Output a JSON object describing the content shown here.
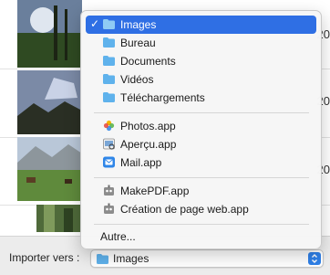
{
  "list": {
    "rows": [
      {
        "date_fragment": "20"
      },
      {
        "date_fragment": "20"
      },
      {
        "date_fragment": "20"
      },
      {
        "date_fragment": ""
      }
    ]
  },
  "footer": {
    "label": "Importer vers :",
    "selected_value": "Images"
  },
  "menu": {
    "folders": [
      {
        "label": "Images",
        "checked": "✓",
        "icon": "folder-icon"
      },
      {
        "label": "Bureau",
        "icon": "folder-icon"
      },
      {
        "label": "Documents",
        "icon": "folder-icon"
      },
      {
        "label": "Vidéos",
        "icon": "folder-icon"
      },
      {
        "label": "Téléchargements",
        "icon": "folder-icon"
      }
    ],
    "apps": [
      {
        "label": "Photos.app",
        "icon": "photos-app-icon"
      },
      {
        "label": "Aperçu.app",
        "icon": "preview-app-icon"
      },
      {
        "label": "Mail.app",
        "icon": "mail-app-icon"
      }
    ],
    "automator": [
      {
        "label": "MakePDF.app",
        "icon": "automator-icon"
      },
      {
        "label": "Création de page web.app",
        "icon": "automator-icon"
      }
    ],
    "other": {
      "label": "Autre..."
    }
  },
  "colors": {
    "selection": "#2f6fe4",
    "folder": "#5fb2ec",
    "popup_arrows": "#2f80e8"
  }
}
